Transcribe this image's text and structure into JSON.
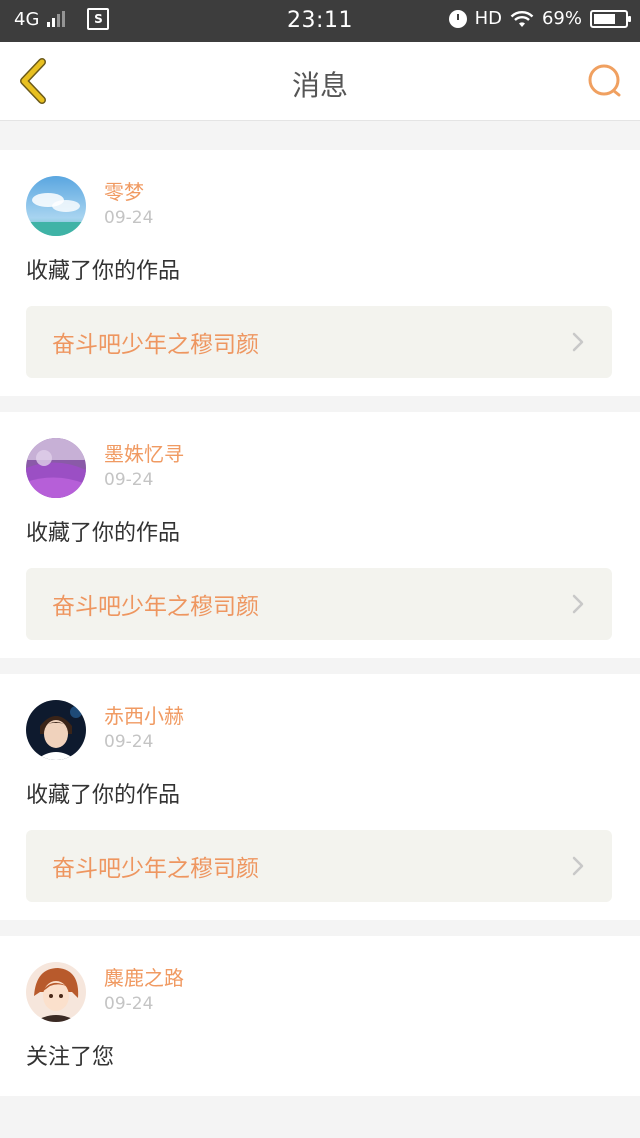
{
  "status_bar": {
    "network": "4G",
    "app_icon": "S",
    "time": "23:11",
    "hd": "HD",
    "battery": "69%",
    "battery_level": 0.69,
    "icons": [
      "signal-icon",
      "app-icon",
      "alarm-icon",
      "wifi-icon",
      "battery-icon"
    ]
  },
  "nav": {
    "title": "消息",
    "back_icon": "chevron-left-icon",
    "search_icon": "search-icon",
    "accent": "#f0a060",
    "back_color": "#e8c020"
  },
  "messages": [
    {
      "user": "零梦",
      "date": "09-24",
      "action": "收藏了你的作品",
      "work": "奋斗吧少年之穆司颜",
      "avatar": "sky-avatar"
    },
    {
      "user": "墨姝忆寻",
      "date": "09-24",
      "action": "收藏了你的作品",
      "work": "奋斗吧少年之穆司颜",
      "avatar": "lavender-avatar"
    },
    {
      "user": "赤西小赫",
      "date": "09-24",
      "action": "收藏了你的作品",
      "work": "奋斗吧少年之穆司颜",
      "avatar": "portrait-avatar"
    },
    {
      "user": "麋鹿之路",
      "date": "09-24",
      "action": "关注了您",
      "avatar": "anime-avatar"
    }
  ],
  "colors": {
    "username": "#f09a62",
    "work_title": "#ee9660",
    "link_bg": "#f3f3ee",
    "date": "#c4c4c4",
    "page_bg": "#f4f4f4"
  }
}
